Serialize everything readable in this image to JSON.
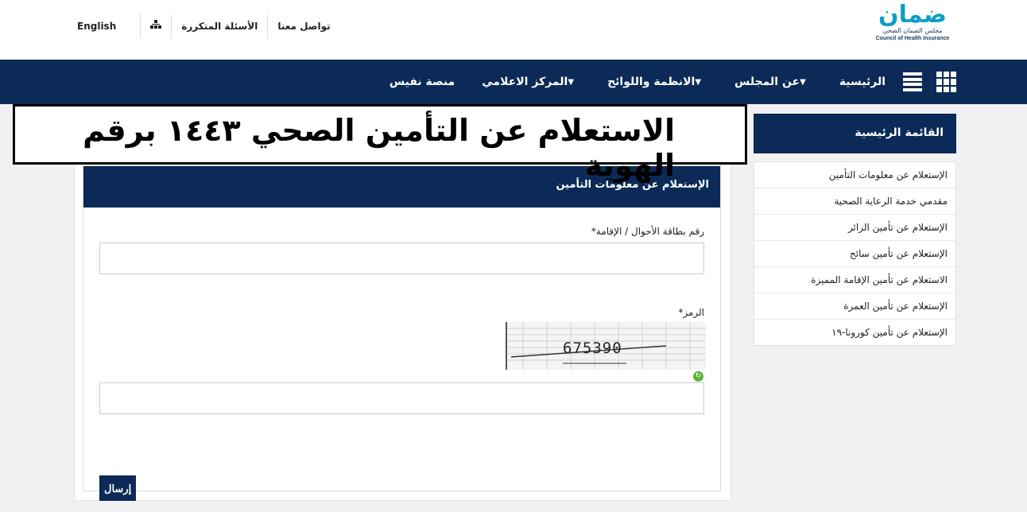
{
  "header": {
    "links": [
      "تواصل معنا",
      "الأسئلة المتكررة"
    ],
    "sitemap_icon": "sitemap-icon",
    "language": "English",
    "logo_main": "ضمان",
    "logo_ar": "مجلس الضمان الصحي",
    "logo_en": "Council of Health Insurance"
  },
  "nav": {
    "items": [
      "الرئيسية",
      "عن المجلس",
      "الانظمة واللوائح",
      "المركز الاعلامي",
      "منصة نفيس"
    ],
    "icons": [
      "apps-grid-icon",
      "menu-bars-icon"
    ]
  },
  "overlay": {
    "title": "الاستعلام عن التأمين الصحي ١٤٤٣ برقم الهوية"
  },
  "form": {
    "title": "الإستعلام عن معلومات التأمين",
    "id_label": "رقم بطاقة الأحوال / الإقامة*",
    "captcha_label": "الرمز*",
    "captcha_code": "675390",
    "submit_label": "إرسال"
  },
  "sidebar": {
    "title": "القائمة الرئيسية",
    "items": [
      "الإستعلام عن معلومات التأمين",
      "مقدمي خدمة الرعاية الصحية",
      "الإستعلام عن تأمين الزائر",
      "الإستعلام عن تأمين سائح",
      "الاستعلام عن تأمين الإقامة المميزة",
      "الإستعلام عن تأمين العمرة",
      "الإستعلام عن تأمين كورونا-١٩"
    ]
  },
  "colors": {
    "navy": "#0b2a57",
    "logo_teal": "#0e9ec4",
    "refresh_green": "#5db03b"
  }
}
